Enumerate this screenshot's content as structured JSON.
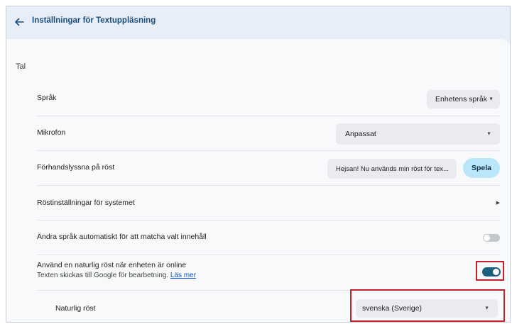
{
  "header": {
    "title": "Inställningar för Textuppläsning",
    "back_icon": "arrow-left-icon"
  },
  "section": {
    "label": "Tal"
  },
  "settings": {
    "language": {
      "label": "Språk",
      "value": "Enhetens språk"
    },
    "microphone": {
      "label": "Mikrofon",
      "value": "Anpassat"
    },
    "preview": {
      "label": "Förhandslyssna på röst",
      "text": "Hejsan! Nu används min röst för tex...",
      "play_label": "Spela"
    },
    "system_voice": {
      "label": "Röstinställningar för systemet"
    },
    "auto_language": {
      "label": "Ändra språk automatiskt för att matcha valt innehåll",
      "enabled": false
    },
    "natural_voice_online": {
      "label": "Använd en naturlig röst när enheten är online",
      "sub_text": "Texten skickas till Google för bearbetning.",
      "link_text": "Läs mer",
      "enabled": true
    },
    "natural_voice": {
      "label": "Naturlig röst",
      "value": "svenska (Sverige)"
    }
  },
  "colors": {
    "highlight": "#c8202a",
    "toggle_on": "#1d5f7e",
    "play_button": "#b9e6fb"
  }
}
